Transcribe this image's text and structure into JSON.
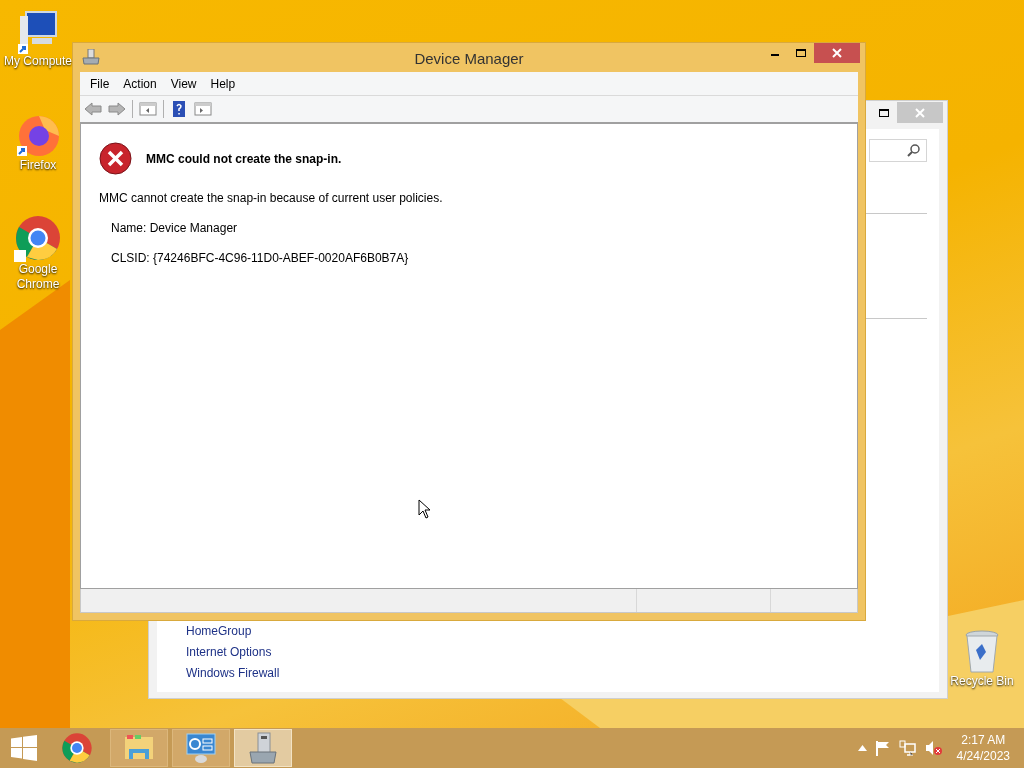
{
  "desktop_icons": [
    {
      "kind": "computer",
      "label": "My Compute"
    },
    {
      "kind": "firefox",
      "label": "Firefox"
    },
    {
      "kind": "chrome",
      "label": "Google Chrome"
    },
    {
      "kind": "recycle",
      "label": "Recycle Bin"
    }
  ],
  "back_window": {
    "links": [
      "HomeGroup",
      "Internet Options",
      "Windows Firewall"
    ]
  },
  "device_manager": {
    "title": "Device Manager",
    "menu": [
      "File",
      "Action",
      "View",
      "Help"
    ],
    "error": {
      "heading": "MMC could not create the snap-in.",
      "message": "MMC cannot create the snap-in because of current user policies.",
      "name": "Name: Device Manager",
      "clsid": "CLSID: {74246BFC-4C96-11D0-ABEF-0020AF6B0B7A}"
    }
  },
  "taskbar": {
    "items": [
      {
        "kind": "start",
        "selected": false
      },
      {
        "kind": "chrome",
        "selected": false
      },
      {
        "kind": "explorer",
        "selected": false
      },
      {
        "kind": "control-panel",
        "selected": false
      },
      {
        "kind": "device-manager",
        "selected": true
      }
    ],
    "time": "2:17 AM",
    "date": "4/24/2023"
  }
}
